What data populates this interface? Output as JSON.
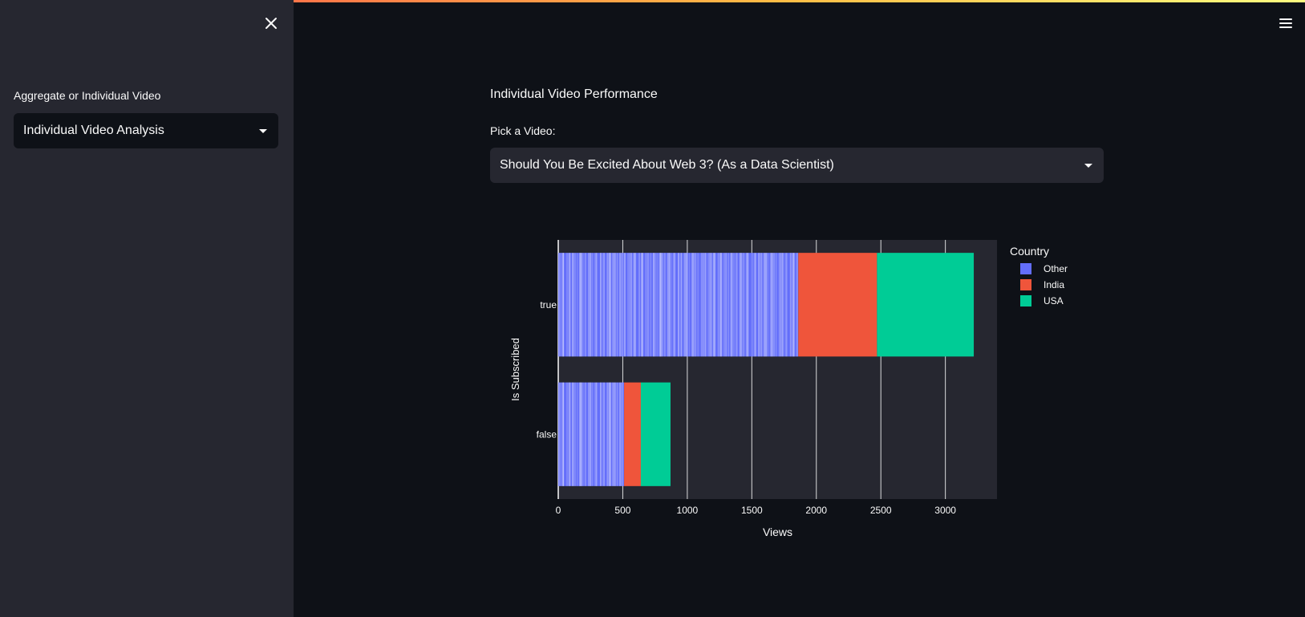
{
  "sidebar": {
    "label": "Aggregate or Individual Video",
    "selected": "Individual Video Analysis"
  },
  "main": {
    "title": "Individual Video Performance",
    "pick_label": "Pick a Video:",
    "selected_video": "Should You Be Excited About Web 3? (As a Data Scientist)"
  },
  "icons": {
    "close": "close-icon",
    "menu": "hamburger-menu-icon",
    "caret": "chevron-down-icon"
  },
  "colors": {
    "accent": "#ff4b4b",
    "other": "#636efa",
    "india": "#ef553b",
    "usa": "#00cc96",
    "plot_bg": "#262730"
  },
  "chart_data": {
    "type": "bar",
    "orientation": "horizontal",
    "barmode": "stack",
    "categories": [
      "true",
      "false"
    ],
    "series": [
      {
        "name": "Other",
        "color": "#636efa",
        "values": [
          1860,
          510
        ]
      },
      {
        "name": "India",
        "color": "#ef553b",
        "values": [
          610,
          130
        ]
      },
      {
        "name": "USA",
        "color": "#00cc96",
        "values": [
          750,
          230
        ]
      }
    ],
    "xlabel": "Views",
    "ylabel": "Is Subscribed",
    "xlim": [
      0,
      3400
    ],
    "xticks": [
      0,
      500,
      1000,
      1500,
      2000,
      2500,
      3000
    ],
    "legend_title": "Country",
    "legend_position": "right",
    "grid": true
  }
}
